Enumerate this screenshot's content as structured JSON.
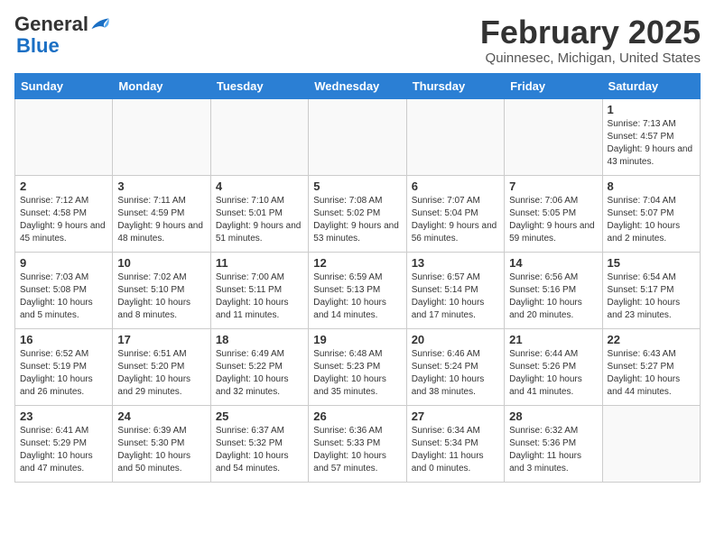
{
  "header": {
    "logo_general": "General",
    "logo_blue": "Blue",
    "month_title": "February 2025",
    "location": "Quinnesec, Michigan, United States"
  },
  "weekdays": [
    "Sunday",
    "Monday",
    "Tuesday",
    "Wednesday",
    "Thursday",
    "Friday",
    "Saturday"
  ],
  "weeks": [
    [
      {
        "day": "",
        "info": ""
      },
      {
        "day": "",
        "info": ""
      },
      {
        "day": "",
        "info": ""
      },
      {
        "day": "",
        "info": ""
      },
      {
        "day": "",
        "info": ""
      },
      {
        "day": "",
        "info": ""
      },
      {
        "day": "1",
        "info": "Sunrise: 7:13 AM\nSunset: 4:57 PM\nDaylight: 9 hours and 43 minutes."
      }
    ],
    [
      {
        "day": "2",
        "info": "Sunrise: 7:12 AM\nSunset: 4:58 PM\nDaylight: 9 hours and 45 minutes."
      },
      {
        "day": "3",
        "info": "Sunrise: 7:11 AM\nSunset: 4:59 PM\nDaylight: 9 hours and 48 minutes."
      },
      {
        "day": "4",
        "info": "Sunrise: 7:10 AM\nSunset: 5:01 PM\nDaylight: 9 hours and 51 minutes."
      },
      {
        "day": "5",
        "info": "Sunrise: 7:08 AM\nSunset: 5:02 PM\nDaylight: 9 hours and 53 minutes."
      },
      {
        "day": "6",
        "info": "Sunrise: 7:07 AM\nSunset: 5:04 PM\nDaylight: 9 hours and 56 minutes."
      },
      {
        "day": "7",
        "info": "Sunrise: 7:06 AM\nSunset: 5:05 PM\nDaylight: 9 hours and 59 minutes."
      },
      {
        "day": "8",
        "info": "Sunrise: 7:04 AM\nSunset: 5:07 PM\nDaylight: 10 hours and 2 minutes."
      }
    ],
    [
      {
        "day": "9",
        "info": "Sunrise: 7:03 AM\nSunset: 5:08 PM\nDaylight: 10 hours and 5 minutes."
      },
      {
        "day": "10",
        "info": "Sunrise: 7:02 AM\nSunset: 5:10 PM\nDaylight: 10 hours and 8 minutes."
      },
      {
        "day": "11",
        "info": "Sunrise: 7:00 AM\nSunset: 5:11 PM\nDaylight: 10 hours and 11 minutes."
      },
      {
        "day": "12",
        "info": "Sunrise: 6:59 AM\nSunset: 5:13 PM\nDaylight: 10 hours and 14 minutes."
      },
      {
        "day": "13",
        "info": "Sunrise: 6:57 AM\nSunset: 5:14 PM\nDaylight: 10 hours and 17 minutes."
      },
      {
        "day": "14",
        "info": "Sunrise: 6:56 AM\nSunset: 5:16 PM\nDaylight: 10 hours and 20 minutes."
      },
      {
        "day": "15",
        "info": "Sunrise: 6:54 AM\nSunset: 5:17 PM\nDaylight: 10 hours and 23 minutes."
      }
    ],
    [
      {
        "day": "16",
        "info": "Sunrise: 6:52 AM\nSunset: 5:19 PM\nDaylight: 10 hours and 26 minutes."
      },
      {
        "day": "17",
        "info": "Sunrise: 6:51 AM\nSunset: 5:20 PM\nDaylight: 10 hours and 29 minutes."
      },
      {
        "day": "18",
        "info": "Sunrise: 6:49 AM\nSunset: 5:22 PM\nDaylight: 10 hours and 32 minutes."
      },
      {
        "day": "19",
        "info": "Sunrise: 6:48 AM\nSunset: 5:23 PM\nDaylight: 10 hours and 35 minutes."
      },
      {
        "day": "20",
        "info": "Sunrise: 6:46 AM\nSunset: 5:24 PM\nDaylight: 10 hours and 38 minutes."
      },
      {
        "day": "21",
        "info": "Sunrise: 6:44 AM\nSunset: 5:26 PM\nDaylight: 10 hours and 41 minutes."
      },
      {
        "day": "22",
        "info": "Sunrise: 6:43 AM\nSunset: 5:27 PM\nDaylight: 10 hours and 44 minutes."
      }
    ],
    [
      {
        "day": "23",
        "info": "Sunrise: 6:41 AM\nSunset: 5:29 PM\nDaylight: 10 hours and 47 minutes."
      },
      {
        "day": "24",
        "info": "Sunrise: 6:39 AM\nSunset: 5:30 PM\nDaylight: 10 hours and 50 minutes."
      },
      {
        "day": "25",
        "info": "Sunrise: 6:37 AM\nSunset: 5:32 PM\nDaylight: 10 hours and 54 minutes."
      },
      {
        "day": "26",
        "info": "Sunrise: 6:36 AM\nSunset: 5:33 PM\nDaylight: 10 hours and 57 minutes."
      },
      {
        "day": "27",
        "info": "Sunrise: 6:34 AM\nSunset: 5:34 PM\nDaylight: 11 hours and 0 minutes."
      },
      {
        "day": "28",
        "info": "Sunrise: 6:32 AM\nSunset: 5:36 PM\nDaylight: 11 hours and 3 minutes."
      },
      {
        "day": "",
        "info": ""
      }
    ]
  ]
}
